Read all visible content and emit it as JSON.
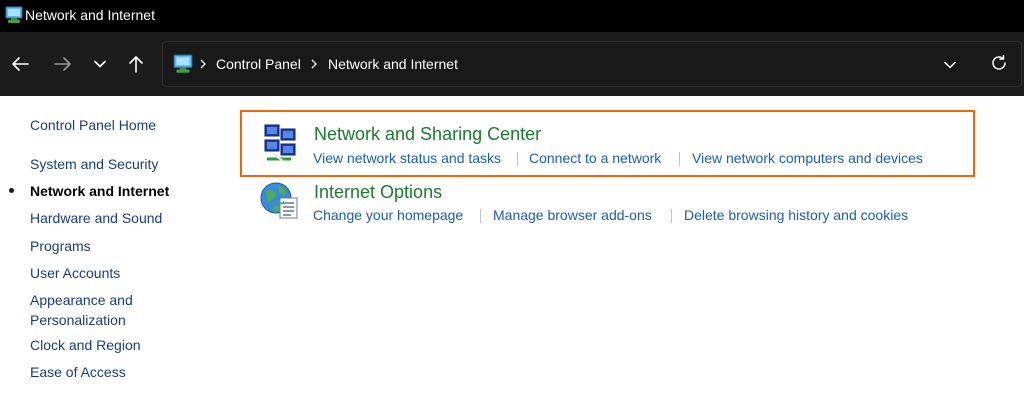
{
  "window": {
    "title": "Network and Internet",
    "icon": "control-panel-icon"
  },
  "navigation": {
    "back_icon": "arrow-left-icon",
    "forward_icon": "arrow-right-icon",
    "recent_icon": "chevron-down-icon",
    "up_icon": "arrow-up-icon"
  },
  "address_bar": {
    "icon": "control-panel-icon",
    "breadcrumbs": [
      "Control Panel",
      "Network and Internet"
    ],
    "dropdown_icon": "chevron-down-icon",
    "refresh_icon": "refresh-icon"
  },
  "sidebar": {
    "home_label": "Control Panel Home",
    "items": [
      {
        "label": "System and Security",
        "current": false
      },
      {
        "label": "Network and Internet",
        "current": true
      },
      {
        "label": "Hardware and Sound",
        "current": false
      },
      {
        "label": "Programs",
        "current": false
      },
      {
        "label": "User Accounts",
        "current": false
      },
      {
        "label": "Appearance and",
        "label2": "Personalization",
        "current": false
      },
      {
        "label": "Clock and Region",
        "current": false
      },
      {
        "label": "Ease of Access",
        "current": false
      }
    ]
  },
  "categories": [
    {
      "title": "Network and Sharing Center",
      "icon": "network-sharing-icon",
      "highlighted": true,
      "tasks": [
        "View network status and tasks",
        "Connect to a network",
        "View network computers and devices"
      ]
    },
    {
      "title": "Internet Options",
      "icon": "internet-options-globe-icon",
      "highlighted": false,
      "tasks": [
        "Change your homepage",
        "Manage browser add-ons",
        "Delete browsing history and cookies"
      ]
    }
  ],
  "colors": {
    "titlebar_bg": "#000000",
    "navbar_bg": "#1c1c1c",
    "highlight_border": "#f0640a",
    "category_title": "#1e7a2e",
    "task_link": "#1a5fb4",
    "sidebar_link": "#1a3d7c"
  }
}
